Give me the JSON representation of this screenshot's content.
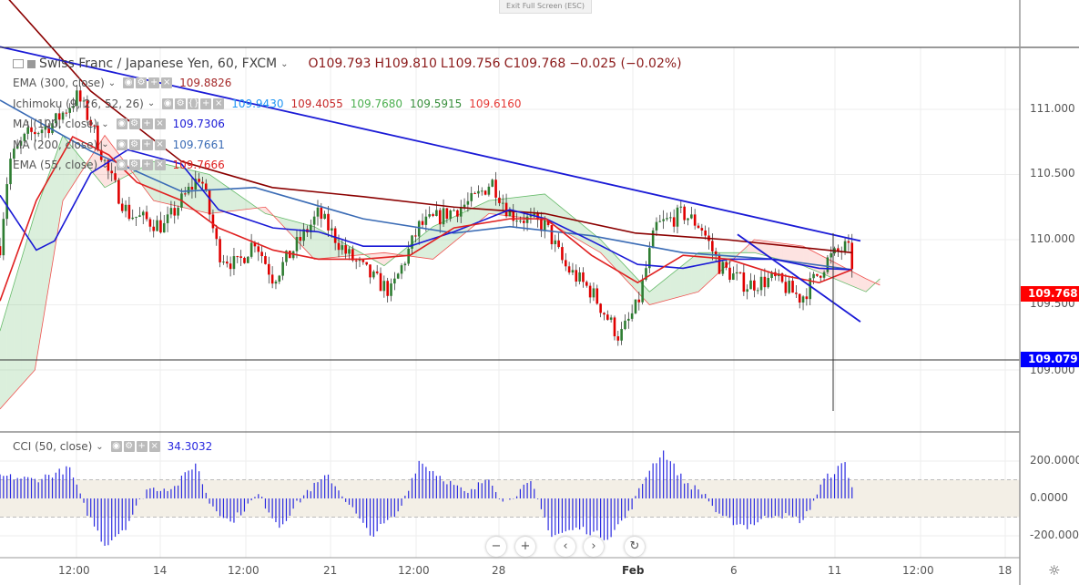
{
  "toolbar": {
    "exit_fullscreen": "Exit Full Screen (ESC)"
  },
  "header": {
    "symbol": "Swiss Franc / Japanese Yen, 60, FXCM",
    "open": "O109.793",
    "high": "H109.810",
    "low": "L109.756",
    "close": "C109.768",
    "change": "−0.025 (−0.02%)"
  },
  "indicators": [
    {
      "label": "EMA (300, close)",
      "values": [
        "109.8826"
      ],
      "colors": [
        "#a52a2a"
      ]
    },
    {
      "label": "Ichimoku (9, 26, 52, 26)",
      "values": [
        "109.9430",
        "109.4055",
        "109.7680",
        "109.5915",
        "109.6160"
      ],
      "colors": [
        "#2196f3",
        "#c62828",
        "#4caf50",
        "#388e3c",
        "#e53935"
      ]
    },
    {
      "label": "MA (100, close)",
      "values": [
        "109.7306"
      ],
      "colors": [
        "#1a1ad6"
      ]
    },
    {
      "label": "MA (200, close)",
      "values": [
        "109.7661"
      ],
      "colors": [
        "#3a6bb5"
      ]
    },
    {
      "label": "EMA (55, close)",
      "values": [
        "109.7666"
      ],
      "colors": [
        "#e02020"
      ]
    }
  ],
  "cci": {
    "label": "CCI (50, close)",
    "value": "34.3032",
    "color": "#2a2ae0"
  },
  "price_axis": [
    "111.000",
    "110.500",
    "110.000",
    "109.500",
    "109.000"
  ],
  "cci_axis": [
    "200.0000",
    "0.0000",
    "-200.0000"
  ],
  "time_axis": [
    "12:00",
    "14",
    "12:00",
    "21",
    "12:00",
    "28",
    "Feb",
    "6",
    "11",
    "12:00",
    "18"
  ],
  "last_price": {
    "value": "109.768",
    "color": "#ff0000"
  },
  "hline": {
    "value": "109.079",
    "color": "#0000ff"
  },
  "nav": [
    "−",
    "+",
    "‹",
    "›",
    "↻"
  ],
  "chart_data": {
    "type": "candlestick",
    "title": "Swiss Franc / Japanese Yen, 60, FXCM",
    "ylim": [
      108.65,
      111.95
    ],
    "price_ticks": [
      111.0,
      110.5,
      110.0,
      109.5,
      109.0
    ],
    "close_path": [
      [
        0,
        109.95
      ],
      [
        1.3,
        110.6
      ],
      [
        3.9,
        110.8
      ],
      [
        7.8,
        110.9
      ],
      [
        11.1,
        111.1
      ],
      [
        13,
        110.9
      ],
      [
        15.6,
        110.5
      ],
      [
        18.3,
        110.2
      ],
      [
        23.5,
        110.1
      ],
      [
        26,
        110.3
      ],
      [
        28.7,
        110.5
      ],
      [
        31.3,
        109.9
      ],
      [
        33.9,
        109.8
      ],
      [
        36.5,
        110.0
      ],
      [
        39.1,
        109.7
      ],
      [
        41.7,
        109.9
      ],
      [
        45.6,
        110.2
      ],
      [
        49.5,
        109.9
      ],
      [
        53.5,
        109.7
      ],
      [
        56,
        109.6
      ],
      [
        60,
        110.1
      ],
      [
        63.9,
        110.2
      ],
      [
        67.8,
        110.3
      ],
      [
        70.4,
        110.45
      ],
      [
        73,
        110.2
      ],
      [
        78.2,
        110.1
      ],
      [
        80.8,
        109.8
      ],
      [
        84.7,
        109.6
      ],
      [
        88.7,
        109.25
      ],
      [
        91.3,
        109.5
      ],
      [
        93.9,
        110.1
      ],
      [
        97.8,
        110.2
      ],
      [
        100.4,
        110.1
      ],
      [
        103,
        109.8
      ],
      [
        106.9,
        109.65
      ],
      [
        110.8,
        109.7
      ],
      [
        114.7,
        109.55
      ],
      [
        118.6,
        109.85
      ],
      [
        121.3,
        109.95
      ],
      [
        122.2,
        109.77
      ]
    ],
    "ema300": [
      [
        0,
        111.92
      ],
      [
        13,
        111.14
      ],
      [
        26,
        110.6
      ],
      [
        39,
        110.4
      ],
      [
        52,
        110.33
      ],
      [
        65,
        110.25
      ],
      [
        78,
        110.2
      ],
      [
        91,
        110.05
      ],
      [
        104,
        110.0
      ],
      [
        122,
        109.9
      ]
    ],
    "ma200": [
      [
        0,
        111.07
      ],
      [
        13,
        110.68
      ],
      [
        26,
        110.37
      ],
      [
        36.5,
        110.4
      ],
      [
        52,
        110.16
      ],
      [
        65,
        110.05
      ],
      [
        73,
        110.1
      ],
      [
        84.7,
        110.03
      ],
      [
        97.8,
        109.9
      ],
      [
        110.8,
        109.85
      ],
      [
        122,
        109.77
      ]
    ],
    "ma100": [
      [
        0,
        110.34
      ],
      [
        5.2,
        109.92
      ],
      [
        7.8,
        109.99
      ],
      [
        13,
        110.51
      ],
      [
        18.3,
        110.69
      ],
      [
        26,
        110.58
      ],
      [
        31.3,
        110.23
      ],
      [
        39.1,
        110.09
      ],
      [
        45.6,
        110.06
      ],
      [
        52,
        109.95
      ],
      [
        58.7,
        109.95
      ],
      [
        65,
        110.06
      ],
      [
        73,
        110.23
      ],
      [
        78.2,
        110.16
      ],
      [
        84.7,
        109.99
      ],
      [
        91.3,
        109.81
      ],
      [
        97.8,
        109.78
      ],
      [
        104.3,
        109.85
      ],
      [
        110.8,
        109.85
      ],
      [
        117.3,
        109.78
      ],
      [
        122,
        109.77
      ]
    ],
    "ema55": [
      [
        0,
        109.53
      ],
      [
        5.2,
        110.3
      ],
      [
        10.4,
        110.79
      ],
      [
        15.6,
        110.65
      ],
      [
        19.6,
        110.44
      ],
      [
        26,
        110.3
      ],
      [
        31.3,
        110.09
      ],
      [
        39.1,
        109.92
      ],
      [
        45.6,
        109.85
      ],
      [
        52,
        109.85
      ],
      [
        58.7,
        109.88
      ],
      [
        65,
        110.09
      ],
      [
        73,
        110.16
      ],
      [
        78.2,
        110.16
      ],
      [
        84.7,
        109.88
      ],
      [
        91.3,
        109.67
      ],
      [
        97.8,
        109.88
      ],
      [
        104.3,
        109.85
      ],
      [
        110.8,
        109.74
      ],
      [
        117.3,
        109.67
      ],
      [
        122,
        109.77
      ]
    ],
    "cloud_a": [
      [
        0,
        109.3
      ],
      [
        5,
        110.2
      ],
      [
        9,
        110.8
      ],
      [
        15,
        110.4
      ],
      [
        22,
        110.6
      ],
      [
        30,
        110.5
      ],
      [
        38,
        110.2
      ],
      [
        45,
        110.1
      ],
      [
        55,
        109.8
      ],
      [
        62,
        110.1
      ],
      [
        70,
        110.3
      ],
      [
        78,
        110.35
      ],
      [
        86,
        110.0
      ],
      [
        93,
        109.6
      ],
      [
        100,
        109.9
      ],
      [
        108,
        109.9
      ],
      [
        115,
        109.8
      ],
      [
        124,
        109.6
      ],
      [
        126,
        109.7
      ]
    ],
    "cloud_b": [
      [
        0,
        108.7
      ],
      [
        5,
        109.0
      ],
      [
        9,
        110.3
      ],
      [
        15,
        110.8
      ],
      [
        22,
        110.3
      ],
      [
        30,
        110.2
      ],
      [
        38,
        110.25
      ],
      [
        45,
        109.85
      ],
      [
        55,
        109.9
      ],
      [
        62,
        109.85
      ],
      [
        70,
        110.2
      ],
      [
        78,
        110.15
      ],
      [
        86,
        109.9
      ],
      [
        93,
        109.5
      ],
      [
        100,
        109.6
      ],
      [
        108,
        110.0
      ],
      [
        115,
        109.95
      ],
      [
        124,
        109.7
      ],
      [
        126,
        109.65
      ]
    ],
    "trendlines": [
      [
        [
          0,
          111.48
        ],
        [
          123.2,
          109.99
        ]
      ],
      [
        [
          105.6,
          110.04
        ],
        [
          123.2,
          109.37
        ]
      ]
    ],
    "cci_series": [
      [
        0,
        120
      ],
      [
        5,
        100
      ],
      [
        10,
        160
      ],
      [
        12,
        -40
      ],
      [
        15,
        -250
      ],
      [
        18,
        -150
      ],
      [
        21,
        50
      ],
      [
        25,
        60
      ],
      [
        28,
        190
      ],
      [
        30,
        -20
      ],
      [
        33,
        -130
      ],
      [
        37,
        20
      ],
      [
        40,
        -150
      ],
      [
        44,
        40
      ],
      [
        47,
        120
      ],
      [
        50,
        -30
      ],
      [
        53,
        -200
      ],
      [
        57,
        -80
      ],
      [
        60,
        200
      ],
      [
        63,
        120
      ],
      [
        67,
        20
      ],
      [
        70,
        120
      ],
      [
        72,
        -20
      ],
      [
        76,
        80
      ],
      [
        79,
        -200
      ],
      [
        83,
        -160
      ],
      [
        87,
        -210
      ],
      [
        90,
        -80
      ],
      [
        93,
        160
      ],
      [
        95,
        250
      ],
      [
        98,
        90
      ],
      [
        101,
        20
      ],
      [
        103,
        -100
      ],
      [
        107,
        -150
      ],
      [
        111,
        -80
      ],
      [
        115,
        -120
      ],
      [
        118,
        100
      ],
      [
        121,
        190
      ],
      [
        122.2,
        34
      ]
    ],
    "cci_band": [
      -100,
      100
    ],
    "cci_ylim": [
      -300,
      320
    ]
  }
}
